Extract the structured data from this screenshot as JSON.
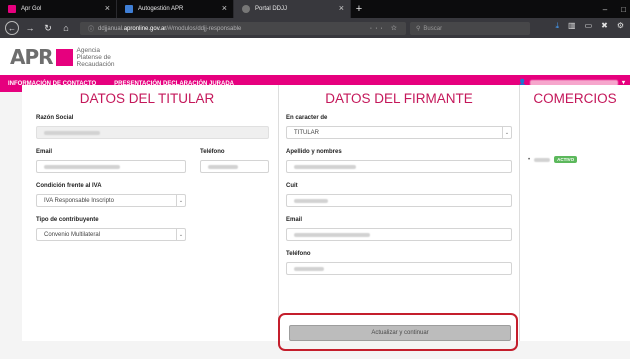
{
  "browser": {
    "tabs": [
      {
        "title": "Apr Gol"
      },
      {
        "title": "Autogestión APR"
      },
      {
        "title": "Portal DDJJ"
      }
    ],
    "new_tab": "+",
    "url_prefix": "ddjjanual.",
    "url_host": "apronline.gov.ar",
    "url_path": "/#/modulos/ddjj-responsable",
    "search_placeholder": "Buscar"
  },
  "header": {
    "logo_text": "APR",
    "logo_line1": "Agencia",
    "logo_line2": "Platense de",
    "logo_line3": "Recaudación"
  },
  "menu": {
    "item1": "INFORMACIÓN DE CONTACTO",
    "item2": "PRESENTACIÓN DECLARACIÓN JURADA"
  },
  "titular": {
    "title": "DATOS DEL TITULAR",
    "razon_label": "Razón Social",
    "email_label": "Email",
    "telefono_label": "Teléfono",
    "iva_label": "Condición frente al IVA",
    "iva_value": "IVA Responsable Inscripto",
    "tipo_label": "Tipo de contribuyente",
    "tipo_value": "Convenio Multilateral"
  },
  "firmante": {
    "title": "DATOS DEL FIRMANTE",
    "caracter_label": "En caracter de",
    "caracter_value": "TITULAR",
    "apellido_label": "Apellido y nombres",
    "cuit_label": "Cuit",
    "email_label": "Email",
    "telefono_label": "Teléfono",
    "submit_label": "Actualizar y continuar"
  },
  "comercios": {
    "title": "COMERCIOS",
    "badge": "ACTIVO"
  }
}
